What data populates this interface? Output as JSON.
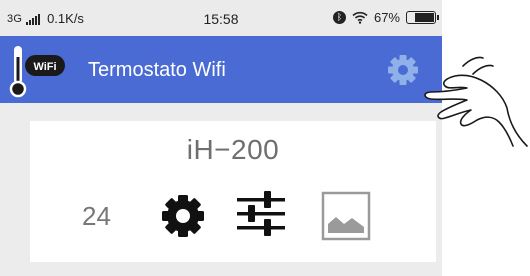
{
  "status_bar": {
    "network": "3G",
    "speed": "0.1K/s",
    "time": "15:58",
    "battery": "67%",
    "battery_level": 0.67,
    "icons": [
      "signal-bars-icon",
      "bluetooth-icon",
      "wifi-icon",
      "battery-icon"
    ]
  },
  "app_bar": {
    "title": "Termostato Wifi",
    "logo_badge": "WiFi",
    "color": "#4a6bd3",
    "action_icon": "settings-gear-icon"
  },
  "device_card": {
    "name": "iH−200",
    "temperature": "24",
    "actions": [
      "gear-icon",
      "sliders-icon",
      "image-icon"
    ]
  },
  "overlay": {
    "pointer": "pointing-hand-icon"
  }
}
